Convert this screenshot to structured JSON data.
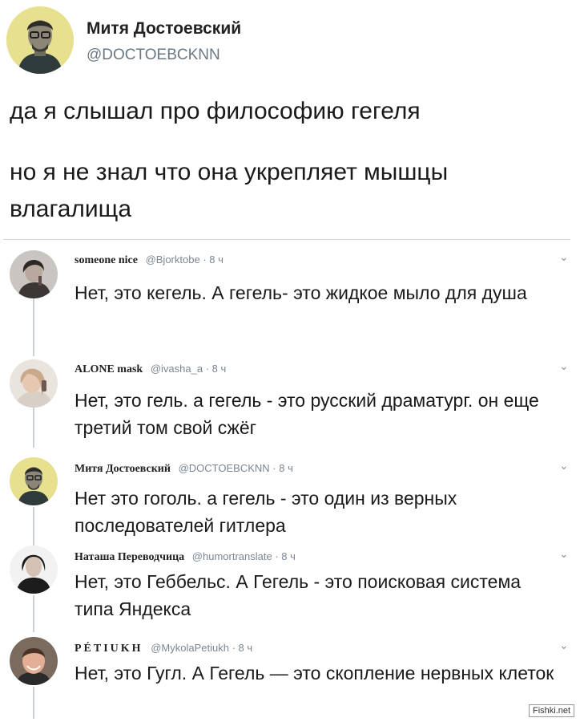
{
  "main_tweet": {
    "name": "Митя Достоевский",
    "handle": "@DOCTOEBCKNN",
    "text_line1": "да я слышал про философию гегеля",
    "text_line2": "но я не знал что она укрепляет мышцы влагалища"
  },
  "colors": {
    "handle_gray": "#6b7782",
    "thread_line": "#c9d1d8",
    "divider": "#cfd6dc"
  },
  "replies": [
    {
      "name": "someone nice",
      "handle": "@Bjorktobe",
      "time": "· 8 ч",
      "text": "Нет, это кегель. А гегель- это жидкое мыло для душа",
      "avatar_icon": "woman-avatar-icon"
    },
    {
      "name": "ALONE mask",
      "handle": "@ivasha_a",
      "time": "· 8 ч",
      "text": "Нет, это гель. а гегель - это русский драматург. он еще третий том свой сжёг",
      "avatar_icon": "girl-avatar-icon"
    },
    {
      "name": "Митя Достоевский",
      "handle": "@DOCTOEBCKNN",
      "time": "· 8 ч",
      "text": "Нет это гоголь. а гегель - это один из верных последователей гитлера",
      "avatar_icon": "man-avatar-icon"
    },
    {
      "name": "Наташа Переводчица",
      "handle": "@humortranslate",
      "time": "· 8 ч",
      "text": "Нет, это Геббельс. А Гегель - это поисковая система типа Яндекса",
      "avatar_icon": "woman-avatar-icon"
    },
    {
      "name": "PÉTIUKH",
      "handle": "@MykolaPetiukh",
      "time": "· 8 ч",
      "text": "Нет, это Гугл. А Гегель — это скопление нервных клеток",
      "avatar_icon": "man-avatar-icon"
    }
  ],
  "chevron_glyph": "⌄",
  "watermark": "Fishki.net"
}
